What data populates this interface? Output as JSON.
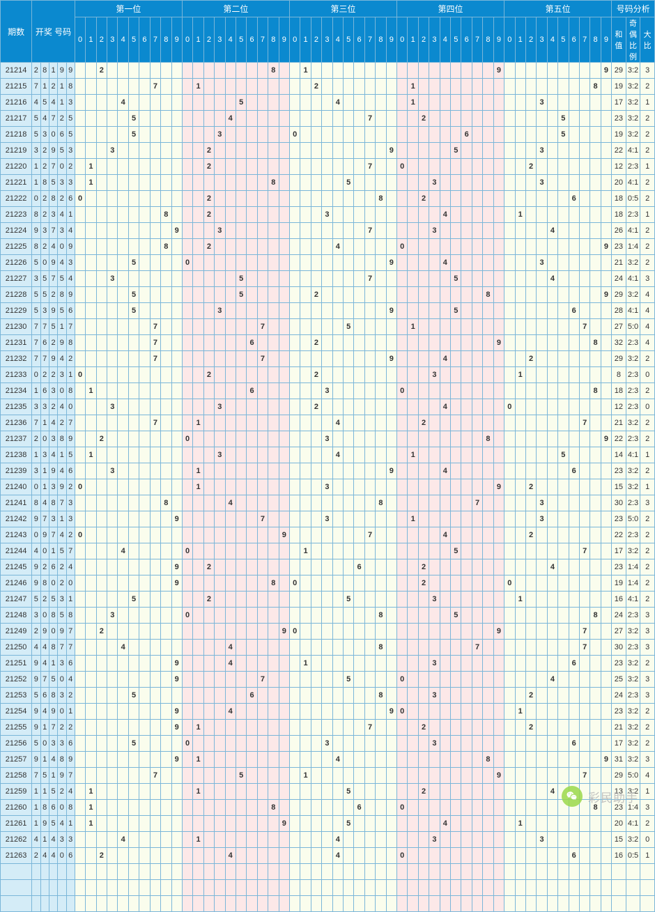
{
  "header": {
    "period": "期数",
    "drawcode": "开奖\n号码",
    "positions": [
      "第一位",
      "第二位",
      "第三位",
      "第四位",
      "第五位"
    ],
    "statgroup": "号码分析",
    "stats": [
      "和\n值",
      "奇偶\n比例",
      "大\n比"
    ]
  },
  "digits": [
    "0",
    "1",
    "2",
    "3",
    "4",
    "5",
    "6",
    "7",
    "8",
    "9"
  ],
  "watermark": "彩民助手",
  "rows": [
    {
      "p": "21214",
      "c": [
        2,
        8,
        1,
        9,
        9
      ],
      "s": [
        "29",
        "3:2",
        "3"
      ]
    },
    {
      "p": "21215",
      "c": [
        7,
        1,
        2,
        1,
        8
      ],
      "s": [
        "19",
        "3:2",
        "2"
      ]
    },
    {
      "p": "21216",
      "c": [
        4,
        5,
        4,
        1,
        3
      ],
      "s": [
        "17",
        "3:2",
        "1"
      ]
    },
    {
      "p": "21217",
      "c": [
        5,
        4,
        7,
        2,
        5
      ],
      "s": [
        "23",
        "3:2",
        "2"
      ]
    },
    {
      "p": "21218",
      "c": [
        5,
        3,
        0,
        6,
        5
      ],
      "s": [
        "19",
        "3:2",
        "2"
      ]
    },
    {
      "p": "21219",
      "c": [
        3,
        2,
        9,
        5,
        3
      ],
      "s": [
        "22",
        "4:1",
        "2"
      ]
    },
    {
      "p": "21220",
      "c": [
        1,
        2,
        7,
        0,
        2
      ],
      "s": [
        "12",
        "2:3",
        "1"
      ]
    },
    {
      "p": "21221",
      "c": [
        1,
        8,
        5,
        3,
        3
      ],
      "s": [
        "20",
        "4:1",
        "2"
      ]
    },
    {
      "p": "21222",
      "c": [
        0,
        2,
        8,
        2,
        6
      ],
      "s": [
        "18",
        "0:5",
        "2"
      ]
    },
    {
      "p": "21223",
      "c": [
        8,
        2,
        3,
        4,
        1
      ],
      "s": [
        "18",
        "2:3",
        "1"
      ]
    },
    {
      "p": "21224",
      "c": [
        9,
        3,
        7,
        3,
        4
      ],
      "s": [
        "26",
        "4:1",
        "2"
      ]
    },
    {
      "p": "21225",
      "c": [
        8,
        2,
        4,
        0,
        9
      ],
      "s": [
        "23",
        "1:4",
        "2"
      ]
    },
    {
      "p": "21226",
      "c": [
        5,
        0,
        9,
        4,
        3
      ],
      "s": [
        "21",
        "3:2",
        "2"
      ]
    },
    {
      "p": "21227",
      "c": [
        3,
        5,
        7,
        5,
        4
      ],
      "s": [
        "24",
        "4:1",
        "3"
      ]
    },
    {
      "p": "21228",
      "c": [
        5,
        5,
        2,
        8,
        9
      ],
      "s": [
        "29",
        "3:2",
        "4"
      ]
    },
    {
      "p": "21229",
      "c": [
        5,
        3,
        9,
        5,
        6
      ],
      "s": [
        "28",
        "4:1",
        "4"
      ]
    },
    {
      "p": "21230",
      "c": [
        7,
        7,
        5,
        1,
        7
      ],
      "s": [
        "27",
        "5:0",
        "4"
      ]
    },
    {
      "p": "21231",
      "c": [
        7,
        6,
        2,
        9,
        8
      ],
      "s": [
        "32",
        "2:3",
        "4"
      ]
    },
    {
      "p": "21232",
      "c": [
        7,
        7,
        9,
        4,
        2
      ],
      "s": [
        "29",
        "3:2",
        "2"
      ]
    },
    {
      "p": "21233",
      "c": [
        0,
        2,
        2,
        3,
        1
      ],
      "s": [
        "8",
        "2:3",
        "0"
      ]
    },
    {
      "p": "21234",
      "c": [
        1,
        6,
        3,
        0,
        8
      ],
      "s": [
        "18",
        "2:3",
        "2"
      ]
    },
    {
      "p": "21235",
      "c": [
        3,
        3,
        2,
        4,
        0
      ],
      "s": [
        "12",
        "2:3",
        "0"
      ]
    },
    {
      "p": "21236",
      "c": [
        7,
        1,
        4,
        2,
        7
      ],
      "s": [
        "21",
        "3:2",
        "2"
      ]
    },
    {
      "p": "21237",
      "c": [
        2,
        0,
        3,
        8,
        9
      ],
      "s": [
        "22",
        "2:3",
        "2"
      ]
    },
    {
      "p": "21238",
      "c": [
        1,
        3,
        4,
        1,
        5
      ],
      "s": [
        "14",
        "4:1",
        "1"
      ]
    },
    {
      "p": "21239",
      "c": [
        3,
        1,
        9,
        4,
        6
      ],
      "s": [
        "23",
        "3:2",
        "2"
      ]
    },
    {
      "p": "21240",
      "c": [
        0,
        1,
        3,
        9,
        2
      ],
      "s": [
        "15",
        "3:2",
        "1"
      ]
    },
    {
      "p": "21241",
      "c": [
        8,
        4,
        8,
        7,
        3
      ],
      "s": [
        "30",
        "2:3",
        "3"
      ]
    },
    {
      "p": "21242",
      "c": [
        9,
        7,
        3,
        1,
        3
      ],
      "s": [
        "23",
        "5:0",
        "2"
      ]
    },
    {
      "p": "21243",
      "c": [
        0,
        9,
        7,
        4,
        2
      ],
      "s": [
        "22",
        "2:3",
        "2"
      ]
    },
    {
      "p": "21244",
      "c": [
        4,
        0,
        1,
        5,
        7
      ],
      "s": [
        "17",
        "3:2",
        "2"
      ]
    },
    {
      "p": "21245",
      "c": [
        9,
        2,
        6,
        2,
        4
      ],
      "s": [
        "23",
        "1:4",
        "2"
      ]
    },
    {
      "p": "21246",
      "c": [
        9,
        8,
        0,
        2,
        0
      ],
      "s": [
        "19",
        "1:4",
        "2"
      ]
    },
    {
      "p": "21247",
      "c": [
        5,
        2,
        5,
        3,
        1
      ],
      "s": [
        "16",
        "4:1",
        "2"
      ]
    },
    {
      "p": "21248",
      "c": [
        3,
        0,
        8,
        5,
        8
      ],
      "s": [
        "24",
        "2:3",
        "3"
      ]
    },
    {
      "p": "21249",
      "c": [
        2,
        9,
        0,
        9,
        7
      ],
      "s": [
        "27",
        "3:2",
        "3"
      ]
    },
    {
      "p": "21250",
      "c": [
        4,
        4,
        8,
        7,
        7
      ],
      "s": [
        "30",
        "2:3",
        "3"
      ]
    },
    {
      "p": "21251",
      "c": [
        9,
        4,
        1,
        3,
        6
      ],
      "s": [
        "23",
        "3:2",
        "2"
      ]
    },
    {
      "p": "21252",
      "c": [
        9,
        7,
        5,
        0,
        4
      ],
      "s": [
        "25",
        "3:2",
        "3"
      ]
    },
    {
      "p": "21253",
      "c": [
        5,
        6,
        8,
        3,
        2
      ],
      "s": [
        "24",
        "2:3",
        "3"
      ]
    },
    {
      "p": "21254",
      "c": [
        9,
        4,
        9,
        0,
        1
      ],
      "s": [
        "23",
        "3:2",
        "2"
      ]
    },
    {
      "p": "21255",
      "c": [
        9,
        1,
        7,
        2,
        2
      ],
      "s": [
        "21",
        "3:2",
        "2"
      ]
    },
    {
      "p": "21256",
      "c": [
        5,
        0,
        3,
        3,
        6
      ],
      "s": [
        "17",
        "3:2",
        "2"
      ]
    },
    {
      "p": "21257",
      "c": [
        9,
        1,
        4,
        8,
        9
      ],
      "s": [
        "31",
        "3:2",
        "3"
      ]
    },
    {
      "p": "21258",
      "c": [
        7,
        5,
        1,
        9,
        7
      ],
      "s": [
        "29",
        "5:0",
        "4"
      ]
    },
    {
      "p": "21259",
      "c": [
        1,
        1,
        5,
        2,
        4
      ],
      "s": [
        "13",
        "3:2",
        "1"
      ]
    },
    {
      "p": "21260",
      "c": [
        1,
        8,
        6,
        0,
        8
      ],
      "s": [
        "23",
        "1:4",
        "3"
      ]
    },
    {
      "p": "21261",
      "c": [
        1,
        9,
        5,
        4,
        1
      ],
      "s": [
        "20",
        "4:1",
        "2"
      ]
    },
    {
      "p": "21262",
      "c": [
        4,
        1,
        4,
        3,
        3
      ],
      "s": [
        "15",
        "3:2",
        "0"
      ]
    },
    {
      "p": "21263",
      "c": [
        2,
        4,
        4,
        0,
        6
      ],
      "s": [
        "16",
        "0:5",
        "1"
      ]
    }
  ],
  "blank_rows": 3
}
